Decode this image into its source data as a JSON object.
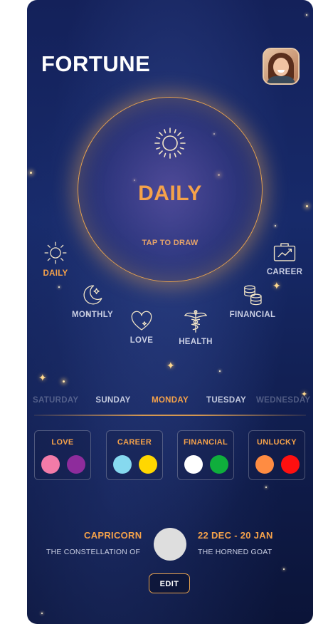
{
  "app": {
    "title": "FORTUNE"
  },
  "profile": {
    "avatar_icon": "user-avatar"
  },
  "orb": {
    "title": "DAILY",
    "subtitle": "TAP TO DRAW",
    "icon": "sun-icon",
    "accent": "#f5a24a"
  },
  "categories": [
    {
      "label": "DAILY",
      "icon": "sun-icon",
      "active": true
    },
    {
      "label": "CAREER",
      "icon": "briefcase-chart-icon",
      "active": false
    },
    {
      "label": "MONTHLY",
      "icon": "moon-star-icon",
      "active": false
    },
    {
      "label": "FINANCIAL",
      "icon": "coins-icon",
      "active": false
    },
    {
      "label": "LOVE",
      "icon": "heart-icon",
      "active": false
    },
    {
      "label": "HEALTH",
      "icon": "caduceus-icon",
      "active": false
    }
  ],
  "days": [
    "SATURDAY",
    "SUNDAY",
    "MONDAY",
    "TUESDAY",
    "WEDNESDAY"
  ],
  "active_day": "MONDAY",
  "lucky_colors": [
    {
      "label": "LOVE",
      "colors": [
        "#f27ba8",
        "#8e2c9c"
      ]
    },
    {
      "label": "CAREER",
      "colors": [
        "#86d9ef",
        "#ffd700"
      ]
    },
    {
      "label": "FINANCIAL",
      "colors": [
        "#ffffff",
        "#0fae3c"
      ]
    },
    {
      "label": "UNLUCKY",
      "colors": [
        "#ff8c42",
        "#ff1010"
      ]
    }
  ],
  "zodiac": {
    "name": "CAPRICORN",
    "description": "THE CONSTELLATION OF",
    "dates": "22 DEC - 20 JAN",
    "symbol": "THE HORNED GOAT"
  },
  "actions": {
    "edit_label": "EDIT"
  }
}
